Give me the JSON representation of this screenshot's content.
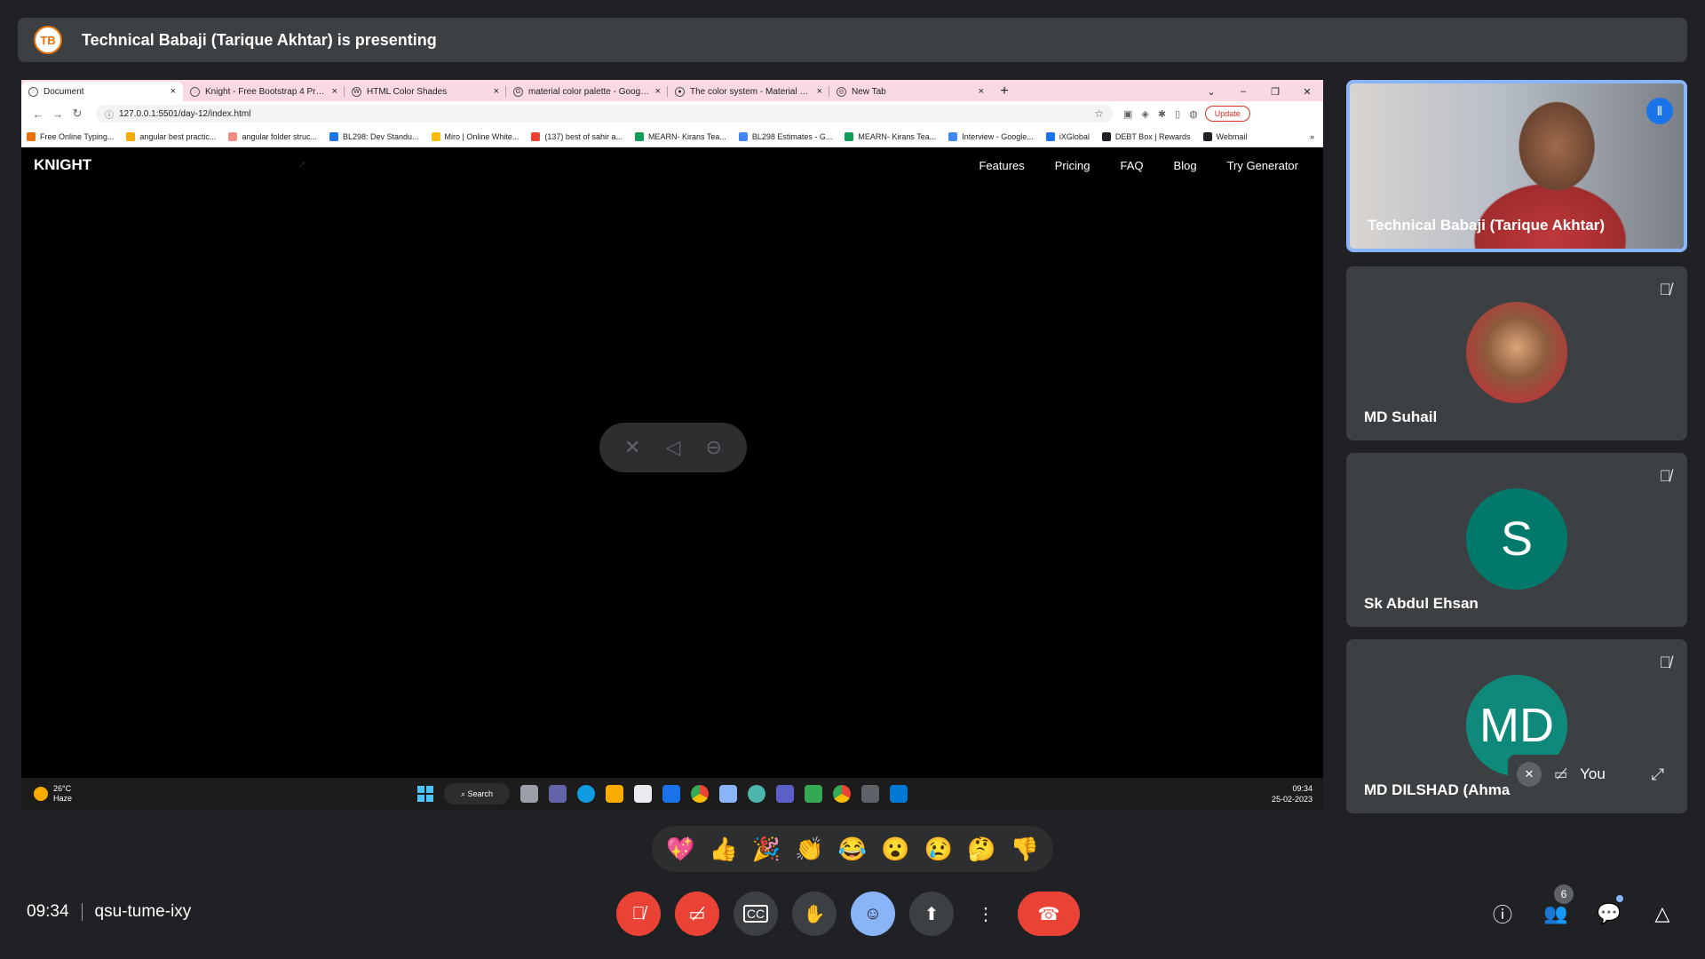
{
  "banner": {
    "logo_text": "TB",
    "text": "Technical Babaji (Tarique Akhtar) is presenting"
  },
  "browser": {
    "tabs": [
      {
        "label": "Document",
        "active": true
      },
      {
        "label": "Knight - Free Bootstrap 4 Produ",
        "active": false
      },
      {
        "label": "HTML Color Shades",
        "active": false
      },
      {
        "label": "material color palette - Google S",
        "active": false
      },
      {
        "label": "The color system - Material Desi",
        "active": false
      },
      {
        "label": "New Tab",
        "active": false
      }
    ],
    "tab_close": "×",
    "new_tab": "+",
    "url": "127.0.0.1:5501/day-12/index.html",
    "update_label": "Update",
    "bookmarks": [
      {
        "label": "Free Online Typing...",
        "color": "#e8710a"
      },
      {
        "label": "angular best practic...",
        "color": "#f9ab00"
      },
      {
        "label": "angular folder struc...",
        "color": "#f28b82"
      },
      {
        "label": "BL298: Dev Standu...",
        "color": "#1a73e8"
      },
      {
        "label": "Miro | Online White...",
        "color": "#fbbc04"
      },
      {
        "label": "(137) best of sahir a...",
        "color": "#ea4335"
      },
      {
        "label": "MEARN- Kirans Tea...",
        "color": "#0f9d58"
      },
      {
        "label": "BL298 Estimates - G...",
        "color": "#4285f4"
      },
      {
        "label": "MEARN- Kirans Tea...",
        "color": "#0f9d58"
      },
      {
        "label": "Interview - Google...",
        "color": "#4285f4"
      },
      {
        "label": "iXGlobal",
        "color": "#1a73e8"
      },
      {
        "label": "DEBT Box | Rewards",
        "color": "#202124"
      },
      {
        "label": "Webmail",
        "color": "#202124"
      }
    ],
    "bookmarks_more": "»"
  },
  "site": {
    "logo": "KNIGHT",
    "nav": [
      "Features",
      "Pricing",
      "FAQ",
      "Blog",
      "Try Generator"
    ]
  },
  "taskbar": {
    "weather_temp": "26°C",
    "weather_desc": "Haze",
    "search_label": "Search",
    "time": "09:34",
    "date": "25-02-2023"
  },
  "participants": [
    {
      "name": "Technical Babaji (Tarique Akhtar)",
      "role": "presenter"
    },
    {
      "name": "MD Suhail",
      "avatar": "photo"
    },
    {
      "name": "Sk Abdul Ehsan",
      "avatar": "S"
    },
    {
      "name": "MD DILSHAD (Ahma",
      "avatar": "MD"
    }
  ],
  "self": {
    "label": "You"
  },
  "reactions": [
    "💖",
    "👍",
    "🎉",
    "👏",
    "😂",
    "😮",
    "😢",
    "🤔",
    "👎"
  ],
  "meeting": {
    "time": "09:34",
    "code": "qsu-tume-ixy"
  },
  "people_count": "6",
  "colors": {
    "accent": "#8ab4f8",
    "danger": "#ea4335",
    "surface": "#3c4043",
    "background": "#202124"
  }
}
